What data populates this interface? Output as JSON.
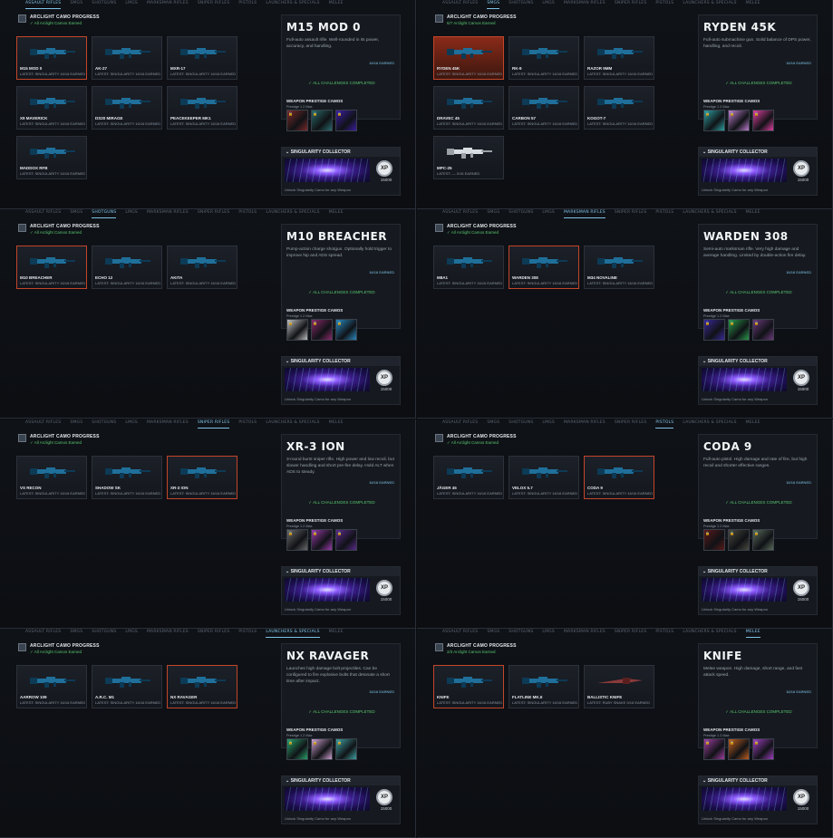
{
  "tabs": [
    "ASSAULT RIFLES",
    "SMGS",
    "SHOTGUNS",
    "LMGS",
    "MARKSMAN RIFLES",
    "SNIPER RIFLES",
    "PISTOLS",
    "LAUNCHERS & SPECIALS",
    "MELEE"
  ],
  "shared": {
    "progress_title": "ARCLIGHT CAMO PROGRESS",
    "all_earned": "✓ All Arclight Camos Earned",
    "all_challenges": "✓ ALL CHALLENGES COMPLETED",
    "prestige_label": "WEAPON PRESTIGE CAMOS",
    "prestige_sub": "Prestige 1   2        Max",
    "singularity_title": "SINGULARITY COLLECTOR",
    "xp_badge": "XP",
    "xp_value": "15000",
    "singularity_foot": "Unlock Singularity Camo for any Weapon",
    "latest_full": "LATEST: SINGULARITY  16/16 EARNED"
  },
  "panels": [
    {
      "active_tab": 0,
      "progress_sub": "✓ All Arclight Camos Earned",
      "weapons": [
        {
          "name": "M15 MOD 0",
          "latest": "LATEST: SINGULARITY  16/16 EARNED",
          "sel": true
        },
        {
          "name": "AK-27",
          "latest": "LATEST: SINGULARITY  16/16 EARNED"
        },
        {
          "name": "MXR-17",
          "latest": "LATEST: SINGULARITY  16/16 EARNED"
        },
        {
          "name": "X9 MAVERICK",
          "latest": "LATEST: SINGULARITY  16/16 EARNED"
        },
        {
          "name": "DS20 MIRAGE",
          "latest": "LATEST: SINGULARITY  16/16 EARNED"
        },
        {
          "name": "PEACEKEEPER MK1",
          "latest": "LATEST: SINGULARITY  16/16 EARNED"
        },
        {
          "name": "MADDOX RFB",
          "latest": "LATEST: SINGULARITY  16/16 EARNED"
        }
      ],
      "title": "M15 MOD 0",
      "desc": "Full-auto assault rifle. Well-rounded in its power, accuracy, and handling.",
      "earned": "16/16 EARNED"
    },
    {
      "active_tab": 1,
      "progress_sub": "6/7 Arclight Camos Earned",
      "weapons": [
        {
          "name": "RYDEN 45K",
          "latest": "LATEST: SINGULARITY  16/16 EARNED",
          "sel": true,
          "hot": true
        },
        {
          "name": "RK-9",
          "latest": "LATEST: SINGULARITY  16/16 EARNED"
        },
        {
          "name": "RAZOR 9MM",
          "latest": "LATEST: SINGULARITY  16/16 EARNED"
        },
        {
          "name": "DRAVEC 45",
          "latest": "LATEST: SINGULARITY  16/16 EARNED"
        },
        {
          "name": "CARBON 57",
          "latest": "LATEST: SINGULARITY  16/16 EARNED"
        },
        {
          "name": "KOGOT-7",
          "latest": "LATEST: SINGULARITY  16/16 EARNED"
        },
        {
          "name": "MPC-25",
          "latest": "LATEST:  —       0/16 EARNED",
          "white": true
        }
      ],
      "title": "RYDEN 45K",
      "desc": "Full-auto submachine gun. Solid balance of DPS power, handling, and recoil.",
      "earned": "16/16 EARNED"
    },
    {
      "active_tab": 2,
      "progress_sub": "✓ All Arclight Camos Earned",
      "weapons": [
        {
          "name": "M10 BREACHER",
          "latest": "LATEST: SINGULARITY  16/16 EARNED",
          "sel": true
        },
        {
          "name": "ECHO 12",
          "latest": "LATEST: SINGULARITY  16/16 EARNED"
        },
        {
          "name": "AKITA",
          "latest": "LATEST: SINGULARITY  16/16 EARNED"
        }
      ],
      "title": "M10 BREACHER",
      "desc": "Pump-action charge shotgun. Optionally hold trigger to improve hip and ADS spread.",
      "earned": "16/16 EARNED"
    },
    {
      "active_tab": 4,
      "progress_sub": "✓ All Arclight Camos Earned",
      "weapons": [
        {
          "name": "M8A1",
          "latest": "LATEST: SINGULARITY  16/16 EARNED"
        },
        {
          "name": "WARDEN 308",
          "latest": "LATEST: SINGULARITY  16/16 EARNED",
          "sel": true
        },
        {
          "name": "M34 NOVALINE",
          "latest": "LATEST: SINGULARITY  16/16 EARNED"
        }
      ],
      "title": "WARDEN 308",
      "desc": "Semi-auto marksman rifle. Very high damage and average handling. Limited by double-action fire delay.",
      "earned": "16/16 EARNED"
    },
    {
      "active_tab": 5,
      "progress_sub": "✓ All Arclight Camos Earned",
      "weapons": [
        {
          "name": "VS RECON",
          "latest": "LATEST: SINGULARITY  16/16 EARNED"
        },
        {
          "name": "SHADOW SK",
          "latest": "LATEST: SINGULARITY  16/16 EARNED"
        },
        {
          "name": "XR-3 ION",
          "latest": "LATEST: SINGULARITY  16/16 EARNED",
          "sel": true
        }
      ],
      "title": "XR-3 ION",
      "desc": "3-round burst sniper rifle. High power and low recoil, but slower handling and short pre-fire delay. Hold  ALT  when ADS to steady.",
      "earned": "16/16 EARNED"
    },
    {
      "active_tab": 6,
      "progress_sub": "✓ All Arclight Camos Earned",
      "weapons": [
        {
          "name": "JÄGER 45",
          "latest": "LATEST: SINGULARITY  16/16 EARNED"
        },
        {
          "name": "VELOX 5.7",
          "latest": "LATEST: SINGULARITY  16/16 EARNED"
        },
        {
          "name": "CODA 9",
          "latest": "LATEST: SINGULARITY  16/16 EARNED",
          "sel": true
        }
      ],
      "title": "CODA 9",
      "desc": "Full-auto pistol. High damage and rate of fire, but high recoil and shorter effective ranges.",
      "earned": "16/16 EARNED"
    },
    {
      "active_tab": 7,
      "progress_sub": "✓ All Arclight Camos Earned",
      "weapons": [
        {
          "name": "AARROW 109",
          "latest": "LATEST: SINGULARITY  16/16 EARNED"
        },
        {
          "name": "A.R.C. M1",
          "latest": "LATEST: SINGULARITY  16/16 EARNED"
        },
        {
          "name": "NX RAVAGER",
          "latest": "LATEST: SINGULARITY  16/16 EARNED",
          "sel": true
        }
      ],
      "title": "NX RAVAGER",
      "desc": "Launches high damage bolt projectiles. Can be configured to fire explosive bolts that detonate a short time after impact.",
      "earned": "16/16 EARNED"
    },
    {
      "active_tab": 8,
      "progress_sub": "2/3 Arclight Camos Earned",
      "weapons": [
        {
          "name": "KNIFE",
          "latest": "LATEST: SINGULARITY  16/16 EARNED",
          "sel": true
        },
        {
          "name": "FLATLINE MK.II",
          "latest": "LATEST: SINGULARITY  16/16 EARNED"
        },
        {
          "name": "BALLISTIC KNIFE",
          "latest": "LATEST: RUBY SNAKE  9/16 EARNED",
          "blade": true
        }
      ],
      "title": "KNIFE",
      "desc": "Melee weapon. High damage, short range, and fast attack speed.",
      "earned": "16/16 EARNED"
    }
  ],
  "camo_colors": [
    [
      "#7a2a2a",
      "#2a6a6a",
      "#3b1ea0"
    ],
    [
      "#2ea0a0",
      "#c080d0",
      "#e040a0"
    ],
    [
      "#bfbfbf",
      "#8a2a6a",
      "#2a8ac0"
    ],
    [
      "#3a2a9a",
      "#2a9a4a",
      "#6a3a7a"
    ],
    [
      "#6a6a6a",
      "#9a3aaa",
      "#5a2a8a"
    ],
    [
      "#5a1a1a",
      "#4a4a40",
      "#5a6a5a"
    ],
    [
      "#2aa06a",
      "#d0a0d0",
      "#40a0a0"
    ],
    [
      "#a040a0",
      "#c06020",
      "#a040c0"
    ]
  ]
}
